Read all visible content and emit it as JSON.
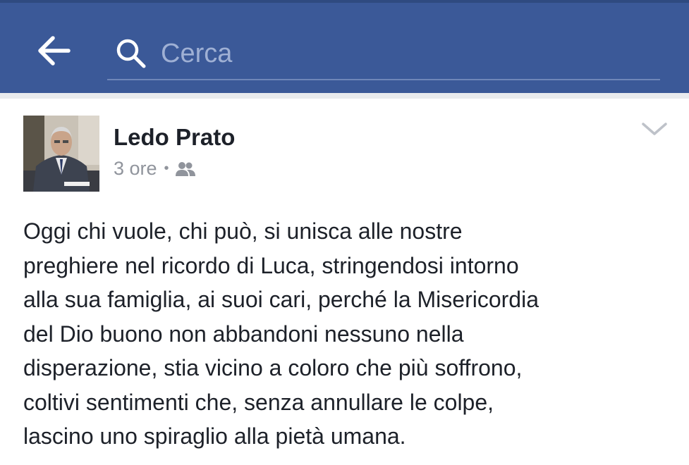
{
  "header": {
    "back_icon": "arrow-left-icon",
    "search_icon": "search-icon",
    "search_placeholder": "Cerca",
    "search_value": "",
    "colors": {
      "bar": "#3b5998",
      "placeholder": "#9fb0d4"
    }
  },
  "post": {
    "author": "Ledo Prato",
    "time": "3 ore",
    "separator": "•",
    "audience_icon": "friends-icon",
    "menu_icon": "chevron-down-icon",
    "lines": [
      "Oggi chi vuole, chi può, si unisca alle nostre",
      "preghiere nel ricordo di Luca, stringendosi intorno",
      "alla sua famiglia, ai suoi cari, perché la Misericordia",
      "del Dio buono non abbandoni nessuno nella",
      "disperazione, stia vicino a coloro che più soffrono,",
      "coltivi sentimenti che, senza annullare le colpe,",
      "lascino uno spiraglio alla pietà umana."
    ]
  }
}
